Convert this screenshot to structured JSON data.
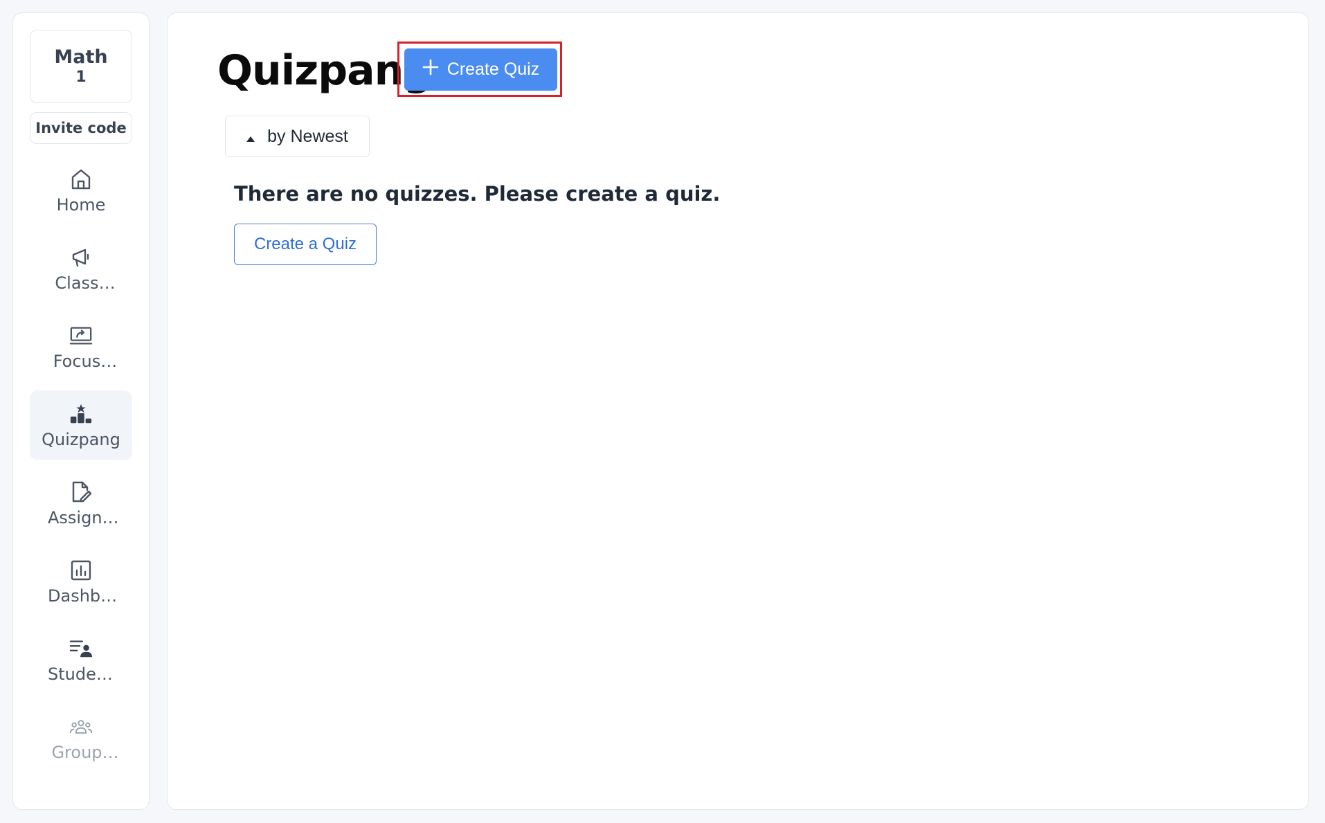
{
  "sidebar": {
    "class_name": "Math",
    "class_number": "1",
    "invite_label": "Invite code",
    "items": [
      {
        "label": "Home",
        "icon": "home-icon"
      },
      {
        "label": "Class…",
        "icon": "megaphone-icon"
      },
      {
        "label": "Focus…",
        "icon": "screen-share-icon"
      },
      {
        "label": "Quizpang",
        "icon": "podium-icon",
        "active": true
      },
      {
        "label": "Assignm…",
        "icon": "edit-document-icon"
      },
      {
        "label": "Dashbo…",
        "icon": "bar-chart-icon"
      },
      {
        "label": "Student…",
        "icon": "student-list-icon"
      },
      {
        "label": "Group…",
        "icon": "group-icon",
        "disabled": true
      }
    ]
  },
  "main": {
    "title": "Quizpang",
    "create_quiz_label": "Create Quiz",
    "sort_label": "by Newest",
    "empty_message": "There are no quizzes. Please create a quiz.",
    "create_a_quiz_label": "Create a Quiz"
  },
  "colors": {
    "primary": "#4a8cf0",
    "highlight_border": "#d6202a",
    "link_blue": "#2f6fcf"
  }
}
